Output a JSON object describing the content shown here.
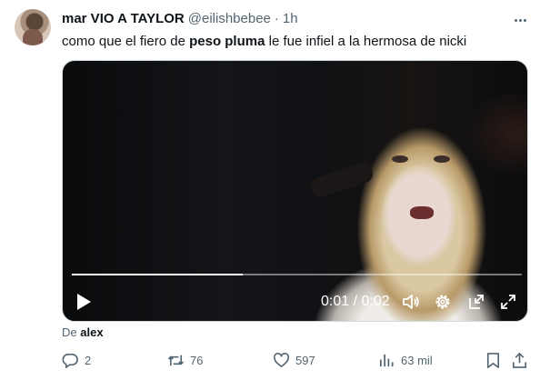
{
  "author": {
    "display_name": "mar VIO A TAYLOR",
    "handle": "@eilishbebee",
    "separator": "·",
    "time": "1h"
  },
  "tweet": {
    "text_before": "como que el fiero de ",
    "text_bold": "peso pluma",
    "text_after": " le fue infiel a la hermosa de nicki"
  },
  "video": {
    "current_time": "0:01",
    "time_separator": " / ",
    "duration": "0:02",
    "progress_fraction": 0.38
  },
  "source": {
    "prefix": "De",
    "name": "alex"
  },
  "actions": {
    "replies": "2",
    "reposts": "76",
    "likes": "597",
    "views": "63 mil"
  },
  "colors": {
    "text_primary": "#0f1419",
    "text_secondary": "#536471",
    "border": "#cfd9de"
  },
  "icons": [
    "more-icon",
    "play-icon",
    "volume-icon",
    "settings-gear-icon",
    "exit-fullscreen-icon",
    "fullscreen-icon",
    "reply-icon",
    "repost-icon",
    "like-icon",
    "views-icon",
    "bookmark-icon",
    "share-icon"
  ]
}
